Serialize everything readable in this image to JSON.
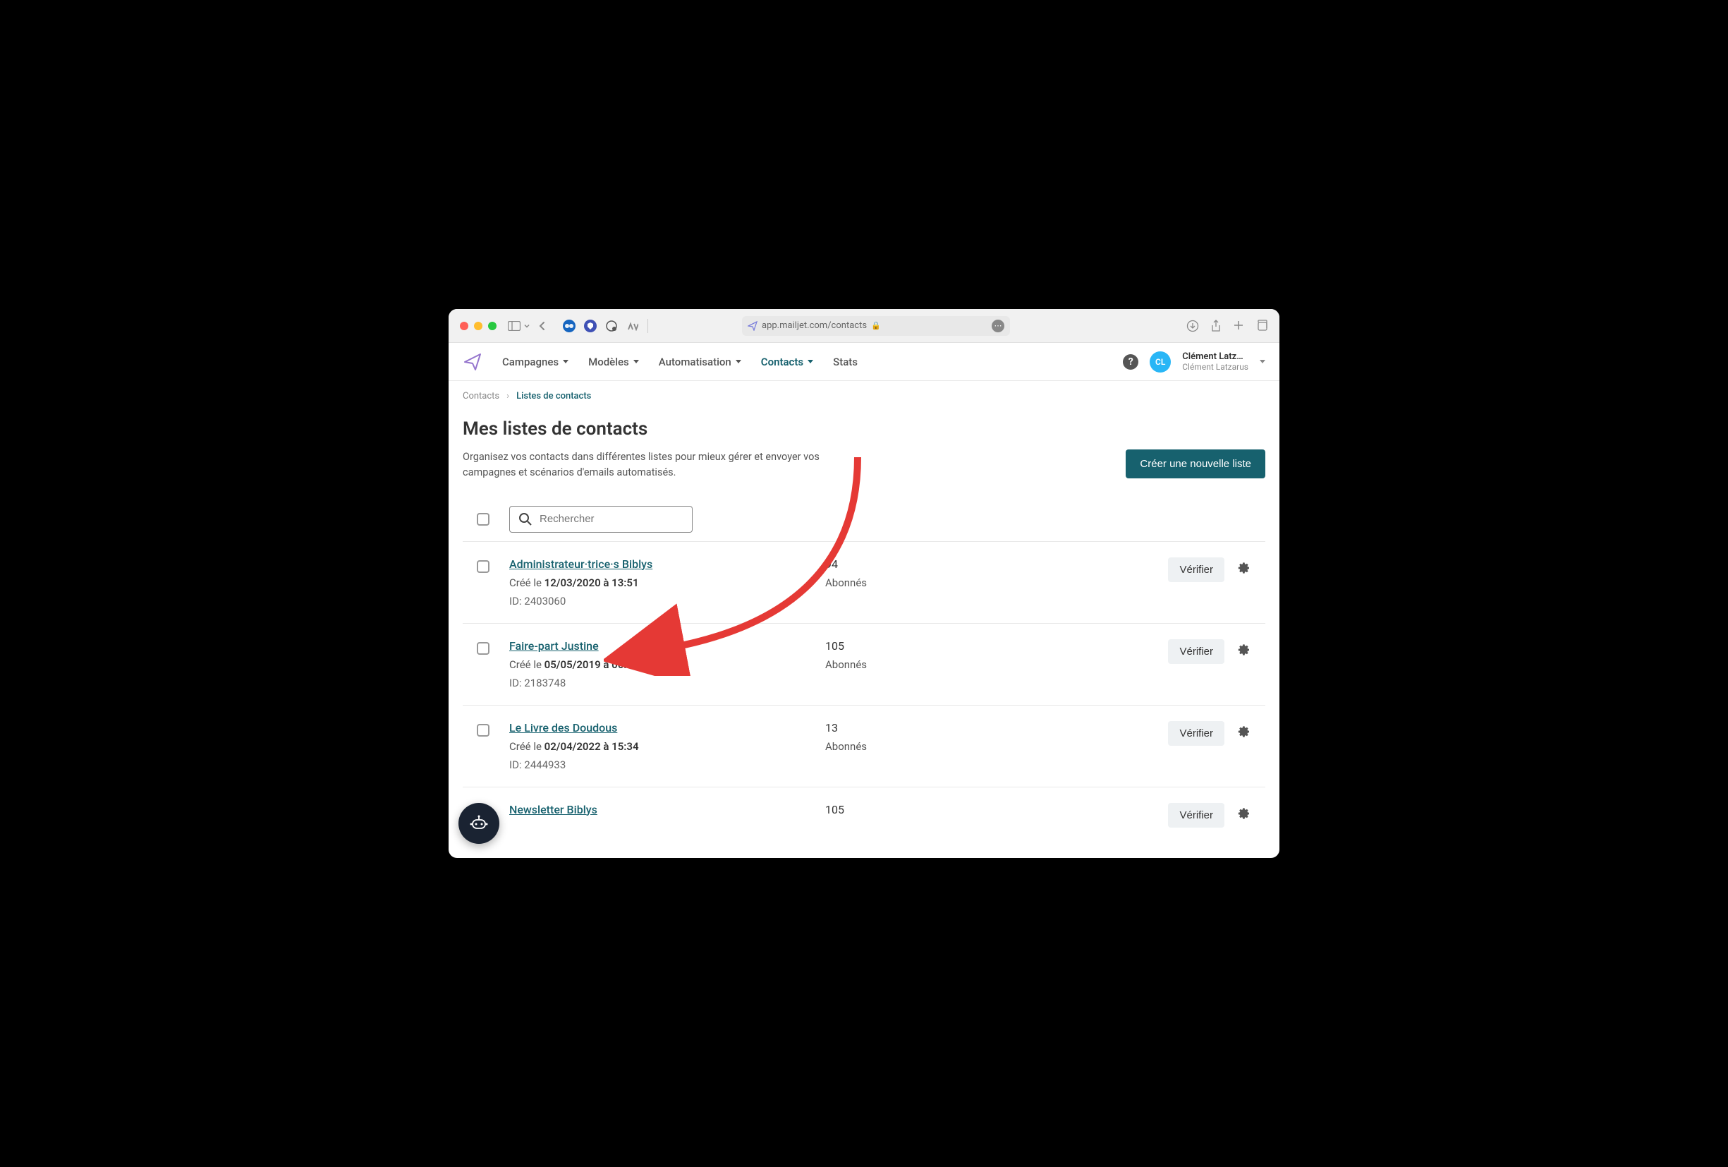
{
  "browser": {
    "url": "app.mailjet.com/contacts"
  },
  "nav": {
    "items": [
      {
        "label": "Campagnes",
        "hasDropdown": true,
        "active": false
      },
      {
        "label": "Modèles",
        "hasDropdown": true,
        "active": false
      },
      {
        "label": "Automatisation",
        "hasDropdown": true,
        "active": false
      },
      {
        "label": "Contacts",
        "hasDropdown": true,
        "active": true
      },
      {
        "label": "Stats",
        "hasDropdown": false,
        "active": false
      }
    ],
    "user": {
      "initials": "CL",
      "name": "Clément Latz…",
      "sub": "Clément Latzarus"
    }
  },
  "breadcrumb": {
    "root": "Contacts",
    "current": "Listes de contacts"
  },
  "page": {
    "title": "Mes listes de contacts",
    "subtitle": "Organisez vos contacts dans différentes listes pour mieux gérer et envoyer vos campagnes et scénarios d'emails automatisés.",
    "create_button": "Créer une nouvelle liste"
  },
  "search": {
    "placeholder": "Rechercher"
  },
  "labels": {
    "created_prefix": "Créé le ",
    "at": " à ",
    "id_prefix": "ID: ",
    "subscribers": "Abonnés",
    "verify": "Vérifier"
  },
  "lists": [
    {
      "name": "Administrateur·trice·s Biblys",
      "date": "12/03/2020",
      "time": "13:51",
      "id": "2403060",
      "count": "94"
    },
    {
      "name": "Faire-part Justine",
      "date": "05/05/2019",
      "time": "06:48",
      "id": "2183748",
      "count": "105"
    },
    {
      "name": "Le Livre des Doudous",
      "date": "02/04/2022",
      "time": "15:34",
      "id": "2444933",
      "count": "13"
    },
    {
      "name": "Newsletter Biblys",
      "date": "",
      "time": "",
      "id": "",
      "count": "105"
    }
  ]
}
